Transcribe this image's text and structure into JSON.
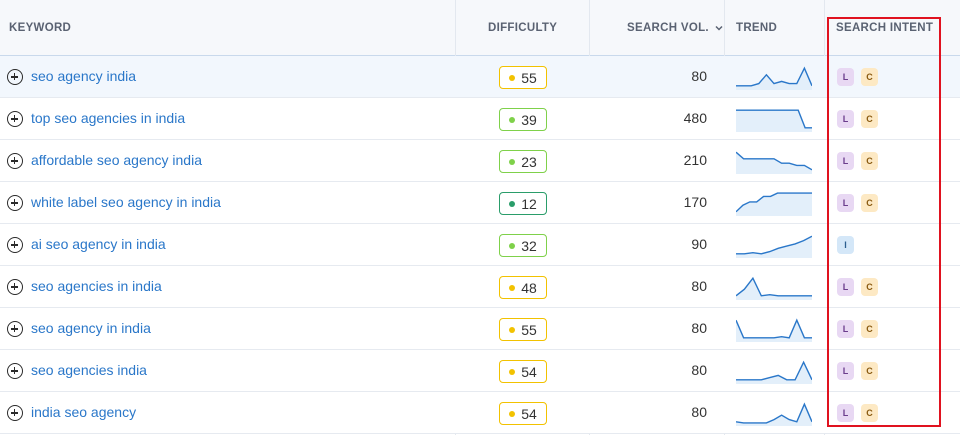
{
  "headers": {
    "keyword": "KEYWORD",
    "difficulty": "DIFFICULTY",
    "search_vol": "SEARCH VOL.",
    "trend": "TREND",
    "search_intent": "SEARCH INTENT"
  },
  "sort_icon": "chevron-down-icon",
  "colors": {
    "link": "#2a77c9",
    "difficulty_yellow": "#f2c200",
    "difficulty_light_green": "#7fd14a",
    "difficulty_green": "#2a9d6a",
    "trend_line": "#2a77c9",
    "trend_fill": "#e3effa",
    "highlight_box": "#e0121f"
  },
  "rows": [
    {
      "keyword": "seo agency india",
      "difficulty": "55",
      "level": "yellow",
      "volume": "80",
      "trend": [
        0.1,
        0.1,
        0.1,
        0.2,
        0.6,
        0.2,
        0.3,
        0.2,
        0.2,
        0.9,
        0.1
      ],
      "intent": [
        "L",
        "C"
      ]
    },
    {
      "keyword": "top seo agencies in india",
      "difficulty": "39",
      "level": "lightgreen",
      "volume": "480",
      "trend": [
        0.9,
        0.9,
        0.9,
        0.9,
        0.9,
        0.9,
        0.9,
        0.9,
        0.9,
        0.9,
        0.1,
        0.1
      ],
      "intent": [
        "L",
        "C"
      ]
    },
    {
      "keyword": "affordable seo agency india",
      "difficulty": "23",
      "level": "lightgreen",
      "volume": "210",
      "trend": [
        0.9,
        0.6,
        0.6,
        0.6,
        0.6,
        0.6,
        0.4,
        0.4,
        0.3,
        0.3,
        0.1
      ],
      "intent": [
        "L",
        "C"
      ]
    },
    {
      "keyword": "white label seo agency in india",
      "difficulty": "12",
      "level": "green",
      "volume": "170",
      "trend": [
        0.1,
        0.4,
        0.55,
        0.55,
        0.8,
        0.8,
        0.95,
        0.95,
        0.95,
        0.95,
        0.95,
        0.95
      ],
      "intent": [
        "L",
        "C"
      ]
    },
    {
      "keyword": "ai seo agency in india",
      "difficulty": "32",
      "level": "lightgreen",
      "volume": "90",
      "trend": [
        0.1,
        0.1,
        0.15,
        0.1,
        0.2,
        0.35,
        0.45,
        0.55,
        0.7,
        0.9
      ],
      "intent": [
        "I"
      ]
    },
    {
      "keyword": "seo agencies in india",
      "difficulty": "48",
      "level": "yellow",
      "volume": "80",
      "trend": [
        0.1,
        0.4,
        0.9,
        0.1,
        0.15,
        0.1,
        0.1,
        0.1,
        0.1,
        0.1
      ],
      "intent": [
        "L",
        "C"
      ]
    },
    {
      "keyword": "seo agency in india",
      "difficulty": "55",
      "level": "yellow",
      "volume": "80",
      "trend": [
        0.9,
        0.1,
        0.1,
        0.1,
        0.1,
        0.1,
        0.15,
        0.1,
        0.9,
        0.1,
        0.1
      ],
      "intent": [
        "L",
        "C"
      ]
    },
    {
      "keyword": "seo agencies india",
      "difficulty": "54",
      "level": "yellow",
      "volume": "80",
      "trend": [
        0.1,
        0.1,
        0.1,
        0.1,
        0.2,
        0.3,
        0.1,
        0.1,
        0.9,
        0.1
      ],
      "intent": [
        "L",
        "C"
      ]
    },
    {
      "keyword": "india seo agency",
      "difficulty": "54",
      "level": "yellow",
      "volume": "80",
      "trend": [
        0.1,
        0.05,
        0.05,
        0.05,
        0.05,
        0.2,
        0.4,
        0.2,
        0.1,
        0.9,
        0.1
      ],
      "intent": [
        "L",
        "C"
      ]
    }
  ]
}
